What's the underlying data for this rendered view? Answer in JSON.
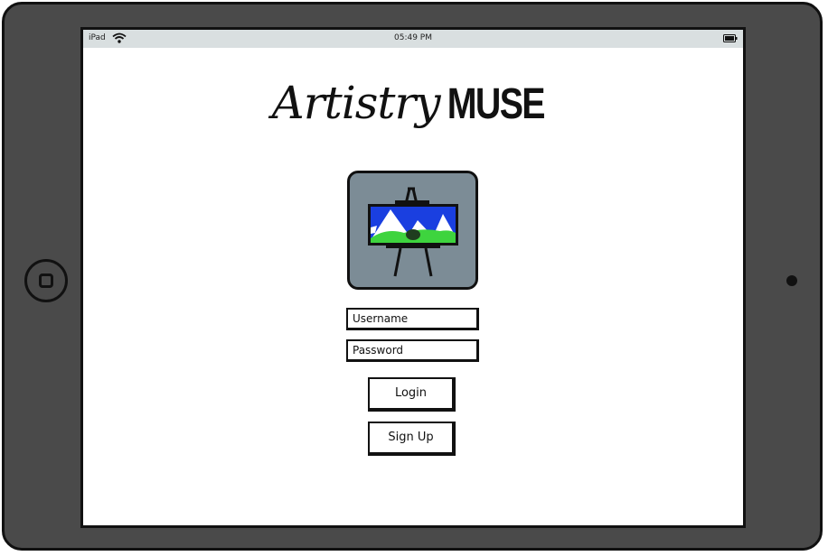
{
  "status_bar": {
    "device": "iPad",
    "time": "05:49 PM",
    "wifi_icon": "wifi-icon",
    "battery_icon": "battery-icon"
  },
  "app": {
    "title_script": "Artistry",
    "title_bold": "MUSE",
    "logo_icon": "easel-painting-icon"
  },
  "login_form": {
    "username_placeholder": "Username",
    "password_placeholder": "Password",
    "login_label": "Login",
    "signup_label": "Sign Up"
  },
  "colors": {
    "device_frame": "#4a4a4a",
    "status_bar": "#d9dfe0",
    "logo_background": "#7c8c96",
    "painting_sky": "#1a3fe0",
    "painting_grass": "#3ed43e"
  }
}
